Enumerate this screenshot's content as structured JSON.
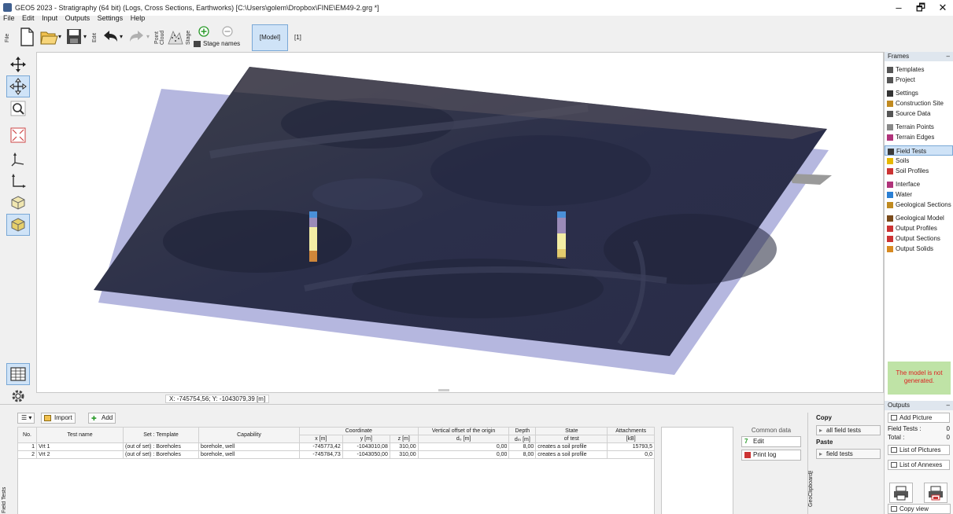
{
  "window": {
    "title": "GEO5 2023 - Stratigraphy (64 bit) (Logs, Cross Sections, Earthworks) [C:\\Users\\golem\\Dropbox\\FINE\\EM49-2.grg *]",
    "minimize": "–",
    "maximize": "🗗",
    "close": "✕"
  },
  "menu": [
    "File",
    "Edit",
    "Input",
    "Outputs",
    "Settings",
    "Help"
  ],
  "toolbar": {
    "file_label": "File",
    "edit_label": "Edit",
    "point_cloud_label": "Point Cloud",
    "stage_label": "Stage",
    "stage_names_label": "Stage names",
    "model_button": "[Model]",
    "stage_number": "[1]"
  },
  "viewport": {
    "coords": "X: -745754,56; Y: -1043079,39 [m]"
  },
  "frames": {
    "header": "Frames",
    "collapse": "–",
    "items": [
      {
        "label": "Templates",
        "icon": "templates-icon",
        "color": "#555555"
      },
      {
        "label": "Project",
        "icon": "project-icon",
        "color": "#555555"
      },
      {
        "label": "Settings",
        "icon": "settings-icon",
        "color": "#333333"
      },
      {
        "label": "Construction Site",
        "icon": "construction-site-icon",
        "color": "#c08a20"
      },
      {
        "label": "Source Data",
        "icon": "source-data-icon",
        "color": "#555555"
      },
      {
        "label": "Terrain Points",
        "icon": "terrain-points-icon",
        "color": "#888888"
      },
      {
        "label": "Terrain Edges",
        "icon": "terrain-edges-icon",
        "color": "#b0337a"
      },
      {
        "label": "Field Tests",
        "icon": "field-tests-icon",
        "color": "#3a3a3a"
      },
      {
        "label": "Soils",
        "icon": "soils-icon",
        "color": "#e6b800"
      },
      {
        "label": "Soil Profiles",
        "icon": "soil-profiles-icon",
        "color": "#cc3333"
      },
      {
        "label": "Interface",
        "icon": "interface-icon",
        "color": "#b0337a"
      },
      {
        "label": "Water",
        "icon": "water-icon",
        "color": "#2a7fd4"
      },
      {
        "label": "Geological Sections",
        "icon": "geological-sections-icon",
        "color": "#c08a20"
      },
      {
        "label": "Geological Model",
        "icon": "geological-model-icon",
        "color": "#7a4a1a"
      },
      {
        "label": "Output Profiles",
        "icon": "output-profiles-icon",
        "color": "#cc3333"
      },
      {
        "label": "Output Sections",
        "icon": "output-sections-icon",
        "color": "#cc3333"
      },
      {
        "label": "Output Solids",
        "icon": "output-solids-icon",
        "color": "#d88a20"
      }
    ],
    "warning": "The model is not generated."
  },
  "outputs": {
    "header": "Outputs",
    "collapse": "–",
    "add_picture": "Add Picture",
    "field_tests_label": "Field Tests :",
    "field_tests_value": "0",
    "total_label": "Total :",
    "total_value": "0",
    "list_of_pictures": "List of Pictures",
    "list_of_annexes": "List of Annexes",
    "copy_view": "Copy view"
  },
  "bottom": {
    "vertical_tab": "Field Tests",
    "import": "Import",
    "add": "Add",
    "table": {
      "headers_top": [
        "No.",
        "Test name",
        "Set : Template",
        "Capability",
        "Coordinate",
        "Vertical offset of the origin",
        "Depth",
        "State",
        "Attachments"
      ],
      "headers_sub": [
        "x [m]",
        "y [m]",
        "z [m]",
        "d₀ [m]",
        "dₘ [m]",
        "of test",
        "[kB]"
      ],
      "rows": [
        {
          "no": "1",
          "name": "Vrt 1",
          "set": "(out of set) : Boreholes",
          "capability": "borehole, well",
          "x": "-745773,42",
          "y": "-1043010,08",
          "z": "310,00",
          "offset": "0,00",
          "depth": "8,00",
          "state": "creates a soil profile",
          "attach": "15793,5"
        },
        {
          "no": "2",
          "name": "Vrt 2",
          "set": "(out of set) : Boreholes",
          "capability": "borehole, well",
          "x": "-745784,73",
          "y": "-1043050,00",
          "z": "310,00",
          "offset": "0,00",
          "depth": "8,00",
          "state": "creates a soil profile",
          "attach": "0,0"
        }
      ]
    },
    "common_data": "Common data",
    "edit": "Edit",
    "print_log": "Print log",
    "clipboard": {
      "copy": "Copy",
      "all_field_tests": "all field tests",
      "paste": "Paste",
      "field_tests": "field tests",
      "vertical": "GeoClipboard™"
    }
  }
}
